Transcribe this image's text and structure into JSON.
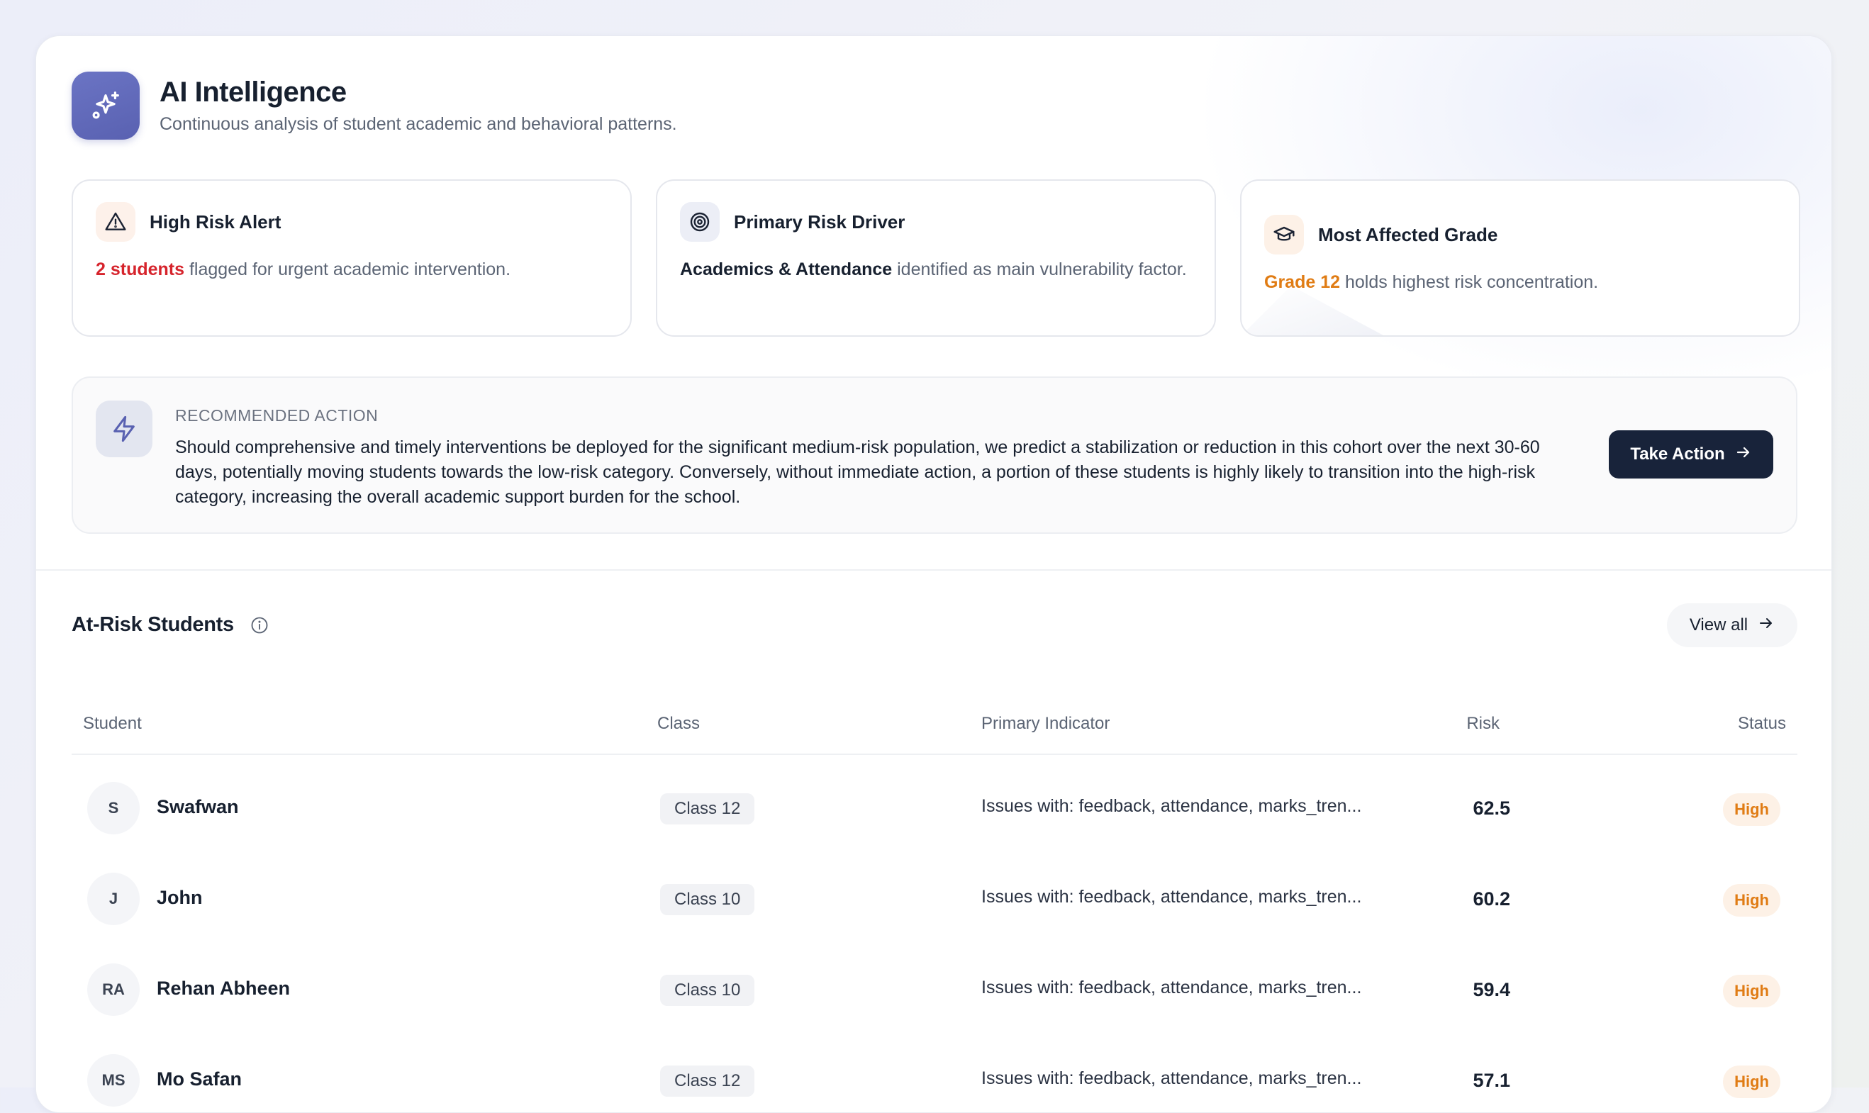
{
  "header": {
    "title": "AI Intelligence",
    "subtitle": "Continuous analysis of student academic and behavioral patterns."
  },
  "cards": [
    {
      "icon": "alert-triangle-icon",
      "title": "High Risk Alert",
      "highlight": "2 students",
      "text": " flagged for urgent academic intervention."
    },
    {
      "icon": "target-icon",
      "title": "Primary Risk Driver",
      "highlight": "Academics & Attendance",
      "text": " identified as main vulnerability factor."
    },
    {
      "icon": "graduation-cap-icon",
      "title": "Most Affected Grade",
      "highlight": "Grade 12",
      "text": " holds highest risk concentration."
    }
  ],
  "recommendation": {
    "label": "RECOMMENDED ACTION",
    "text": "Should comprehensive and timely interventions be deployed for the significant medium-risk population, we predict a stabilization or reduction in this cohort over the next 30-60 days, potentially moving students towards the low-risk category. Conversely, without immediate action, a portion of these students is highly likely to transition into the high-risk category, increasing the overall academic support burden for the school.",
    "button": "Take Action"
  },
  "at_risk": {
    "title": "At-Risk Students",
    "view_all": "View all",
    "columns": [
      "Student",
      "Class",
      "Primary Indicator",
      "Risk",
      "Status"
    ],
    "rows": [
      {
        "initials": "S",
        "name": "Swafwan",
        "class": "Class 12",
        "indicator": "Issues with: feedback, attendance, marks_tren...",
        "risk": "62.5",
        "status": "High"
      },
      {
        "initials": "J",
        "name": "John",
        "class": "Class 10",
        "indicator": "Issues with: feedback, attendance, marks_tren...",
        "risk": "60.2",
        "status": "High"
      },
      {
        "initials": "RA",
        "name": "Rehan Abheen",
        "class": "Class 10",
        "indicator": "Issues with: feedback, attendance, marks_tren...",
        "risk": "59.4",
        "status": "High"
      },
      {
        "initials": "MS",
        "name": "Mo Safan",
        "class": "Class 12",
        "indicator": "Issues with: feedback, attendance, marks_tren...",
        "risk": "57.1",
        "status": "High"
      }
    ]
  },
  "colors": {
    "accent": "#5961b1",
    "danger": "#d6242c",
    "warning": "#e07c14",
    "button_dark": "#18233a"
  }
}
